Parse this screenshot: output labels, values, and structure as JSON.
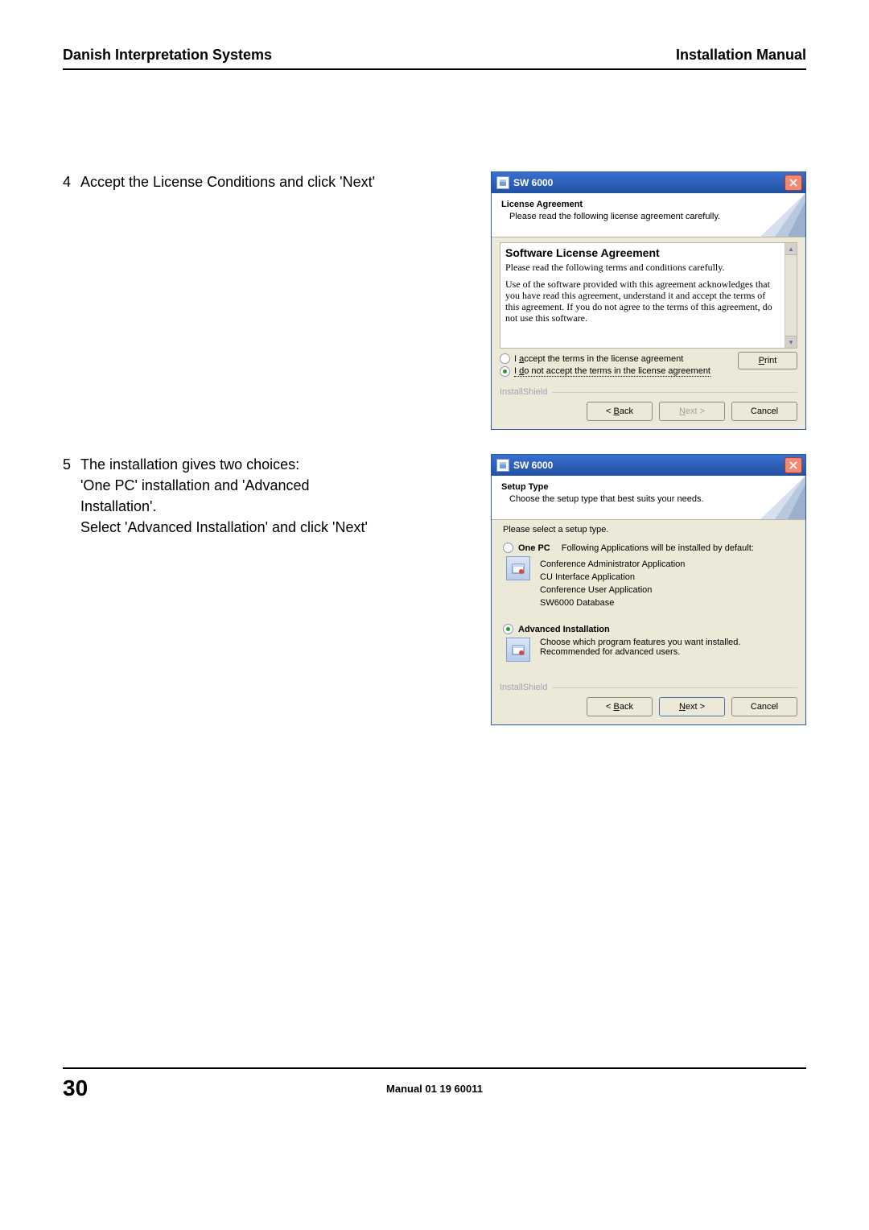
{
  "header": {
    "left": "Danish Interpretation Systems",
    "right": "Installation Manual"
  },
  "steps": [
    {
      "num": "4",
      "lines": [
        "Accept the License Conditions and click 'Next'"
      ]
    },
    {
      "num": "5",
      "lines": [
        "The installation gives two choices:",
        "'One PC' installation and 'Advanced Installation'.",
        "Select 'Advanced Installation' and click 'Next'"
      ]
    }
  ],
  "dialog1": {
    "title": "SW 6000",
    "banner_title": "License Agreement",
    "banner_sub": "Please read the following license agreement carefully.",
    "license_title": "Software License Agreement",
    "license_line": "Please read the following terms and conditions carefully.",
    "license_para": "Use of the software provided with this agreement acknowledges that you have read this agreement, understand it and accept the terms of this agreement. If you do not agree to the terms of this agreement, do not use this software.",
    "radio_accept": "I accept the terms in the license agreement",
    "radio_reject": "I do not accept the terms in the license agreement",
    "print": "Print",
    "brand": "InstallShield",
    "back": "< Back",
    "next": "Next >",
    "cancel": "Cancel"
  },
  "dialog2": {
    "title": "SW 6000",
    "banner_title": "Setup Type",
    "banner_sub": "Choose the setup type that best suits your needs.",
    "prompt": "Please select a setup type.",
    "opt1_label": "One PC",
    "opt1_desc": "Following Applications will be installed by default:",
    "opt1_items": [
      "Conference Administrator Application",
      "CU Interface Application",
      "Conference User Application",
      "SW6000  Database"
    ],
    "opt2_label": "Advanced Installation",
    "opt2_desc": "Choose which program features you want installed. Recommended for advanced users.",
    "brand": "InstallShield",
    "back": "< Back",
    "next": "Next >",
    "cancel": "Cancel"
  },
  "footer": {
    "page": "30",
    "manual": "Manual 01 19 60011"
  }
}
